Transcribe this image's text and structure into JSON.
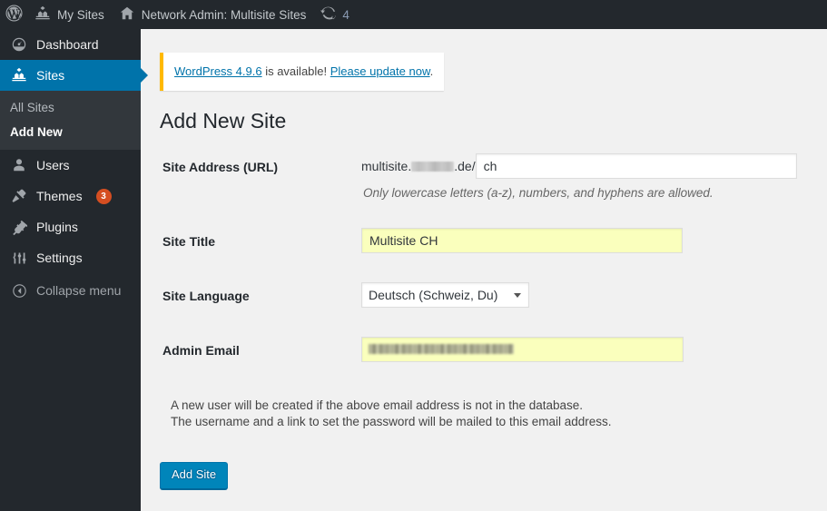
{
  "adminbar": {
    "items": [
      {
        "icon": "wordpress-logo-icon",
        "label": ""
      },
      {
        "icon": "my-sites-icon",
        "label": "My Sites"
      },
      {
        "icon": "home-icon",
        "label": "Network Admin: Multisite Sites"
      },
      {
        "icon": "updates-icon",
        "label": "4"
      }
    ],
    "wp_logo_title": "About WordPress",
    "my_sites_label": "My Sites",
    "network_admin_label": "Network Admin: Multisite Sites",
    "updates_count": "4"
  },
  "sidebar": {
    "items": [
      {
        "label": "Dashboard",
        "icon": "dashboard-icon",
        "current": false
      },
      {
        "label": "Sites",
        "icon": "sites-icon",
        "current": true
      },
      {
        "label": "Users",
        "icon": "users-icon",
        "current": false
      },
      {
        "label": "Themes",
        "icon": "themes-icon",
        "current": false,
        "badge": "3"
      },
      {
        "label": "Plugins",
        "icon": "plugins-icon",
        "current": false
      },
      {
        "label": "Settings",
        "icon": "settings-icon",
        "current": false
      }
    ],
    "submenu": [
      {
        "label": "All Sites",
        "active": false
      },
      {
        "label": "Add New",
        "active": true
      }
    ],
    "collapse_label": "Collapse menu",
    "accent_color": "#0073aa",
    "background_color": "#23282d",
    "submenu_background_color": "#32373c",
    "badge_color": "#d54e21"
  },
  "notice": {
    "link_version": "WordPress 4.9.6",
    "middle_text": " is available! ",
    "link_update": "Please update now",
    "trailing_text": ".",
    "border_color": "#ffb900",
    "link_color": "#0073aa"
  },
  "page": {
    "title": "Add New Site"
  },
  "form": {
    "site_address": {
      "label": "Site Address (URL)",
      "prefix_before": "multisite.",
      "prefix_redacted": "",
      "prefix_after": ".de/",
      "value": "ch",
      "placeholder": "",
      "description": "Only lowercase letters (a-z), numbers, and hyphens are allowed."
    },
    "site_title": {
      "label": "Site Title",
      "value": "Multisite CH",
      "placeholder": "",
      "autofill_color": "#faffbd"
    },
    "site_language": {
      "label": "Site Language",
      "value": "Deutsch (Schweiz, Du)",
      "options": [
        "Deutsch (Schweiz, Du)"
      ]
    },
    "admin_email": {
      "label": "Admin Email",
      "value": "",
      "placeholder": "",
      "autofill_color": "#faffbd"
    },
    "help_line_1": "A new user will be created if the above email address is not in the database.",
    "help_line_2": "The username and a link to set the password will be mailed to this email address.",
    "submit_label": "Add Site",
    "submit_color": "#0085ba"
  }
}
